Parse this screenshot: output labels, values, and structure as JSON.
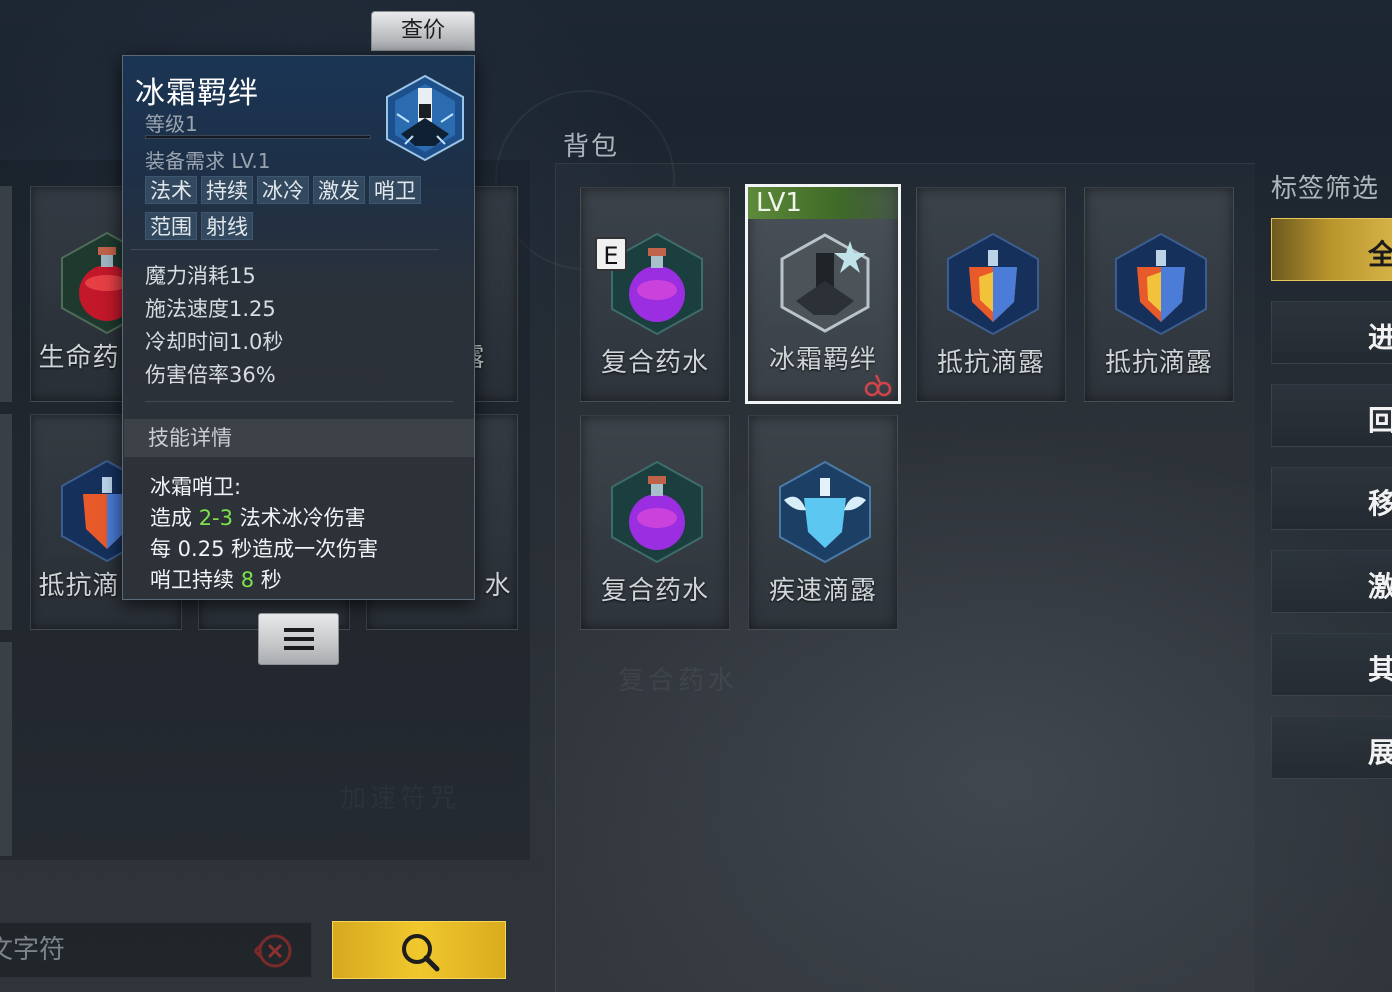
{
  "price_button": "查价",
  "tooltip": {
    "name": "冰霜羁绊",
    "level": "等级1",
    "requirement": "装备需求 LV.1",
    "tags": [
      "法术",
      "持续",
      "冰冷",
      "激发",
      "哨卫",
      "范围",
      "射线"
    ],
    "stats": [
      "魔力消耗15",
      "施法速度1.25",
      "冷却时间1.0秒",
      "伤害倍率36%"
    ],
    "section_title": "技能详情",
    "detail": {
      "line1": "冰霜哨卫:",
      "line2_pre": "造成 ",
      "line2_num": "2-3",
      "line2_post": " 法术冰冷伤害",
      "line3": "每 0.25 秒造成一次伤害",
      "line4_pre": "哨卫持续 ",
      "line4_num": "8",
      "line4_post": " 秒"
    },
    "icon": "frost-sentry-skill-icon"
  },
  "stash": {
    "slots": [
      {
        "label": "生命药",
        "icon": "red-potion-icon"
      },
      {
        "label": "露",
        "icon": "drop-icon"
      },
      {
        "label": "抵抗滴",
        "icon": "rainbow-shield-potion-icon"
      },
      {
        "label": "水",
        "icon": "potion-icon"
      }
    ],
    "watermark": "加速符咒"
  },
  "bag": {
    "title": "背包",
    "watermark": "复合药水",
    "items": [
      {
        "label": "复合药水",
        "icon": "purple-potion-icon",
        "badge": "E"
      },
      {
        "label": "冰霜羁绊",
        "icon": "frost-sentry-skill-icon",
        "level_tag": "LV1",
        "selected": true
      },
      {
        "label": "抵抗滴露",
        "icon": "rainbow-shield-potion-icon"
      },
      {
        "label": "抵抗滴露",
        "icon": "rainbow-shield-potion-icon"
      },
      {
        "label": "复合药水",
        "icon": "purple-potion-icon"
      },
      {
        "label": "疾速滴露",
        "icon": "blue-wing-potion-icon"
      }
    ]
  },
  "filters": {
    "title": "标签筛选",
    "buttons": [
      "全",
      "进",
      "回",
      "移",
      "激",
      "其",
      "展"
    ],
    "active_index": 0
  },
  "search": {
    "placeholder": "文字符",
    "accent_color": "#f0c82d"
  }
}
